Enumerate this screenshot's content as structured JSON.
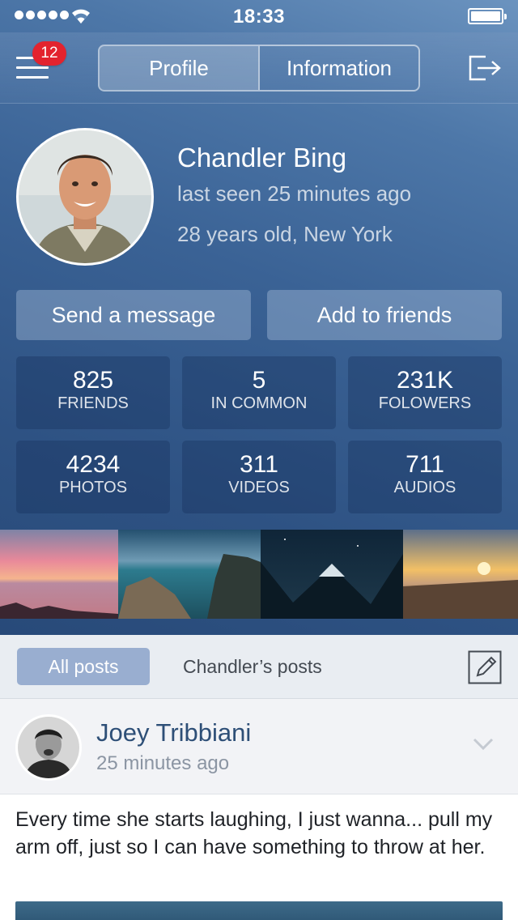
{
  "status_bar": {
    "time": "18:33",
    "signal_bars": 5
  },
  "nav": {
    "badge_count": "12",
    "segments": [
      "Profile",
      "Information"
    ],
    "active_segment": "Profile"
  },
  "profile": {
    "name": "Chandler Bing",
    "last_seen": "last seen 25 minutes ago",
    "details": "28 years old, New York"
  },
  "actions": {
    "send_message": "Send a message",
    "add_friend": "Add to friends"
  },
  "stats": [
    {
      "value": "825",
      "label": "FRIENDS"
    },
    {
      "value": "5",
      "label": "IN COMMON"
    },
    {
      "value": "231K",
      "label": "FOLOWERS"
    },
    {
      "value": "4234",
      "label": "PHOTOS"
    },
    {
      "value": "311",
      "label": "VIDEOS"
    },
    {
      "value": "711",
      "label": "AUDIOS"
    }
  ],
  "photo_icons": [
    "sunset-sea-photo",
    "coastal-cliff-photo",
    "night-mountain-photo",
    "beach-sunset-photo"
  ],
  "feed_tabs": {
    "all": "All posts",
    "own": "Chandler’s posts"
  },
  "post": {
    "author": "Joey Tribbiani",
    "time": "25 minutes ago",
    "text": "Every time she starts laughing, I just wanna... pull my arm off, just so I can have something to throw at her."
  },
  "colors": {
    "accent_blue": "#3a6295",
    "badge_red": "#e3232e",
    "tab_active": "#99aed0",
    "author_blue": "#2e4f77"
  }
}
